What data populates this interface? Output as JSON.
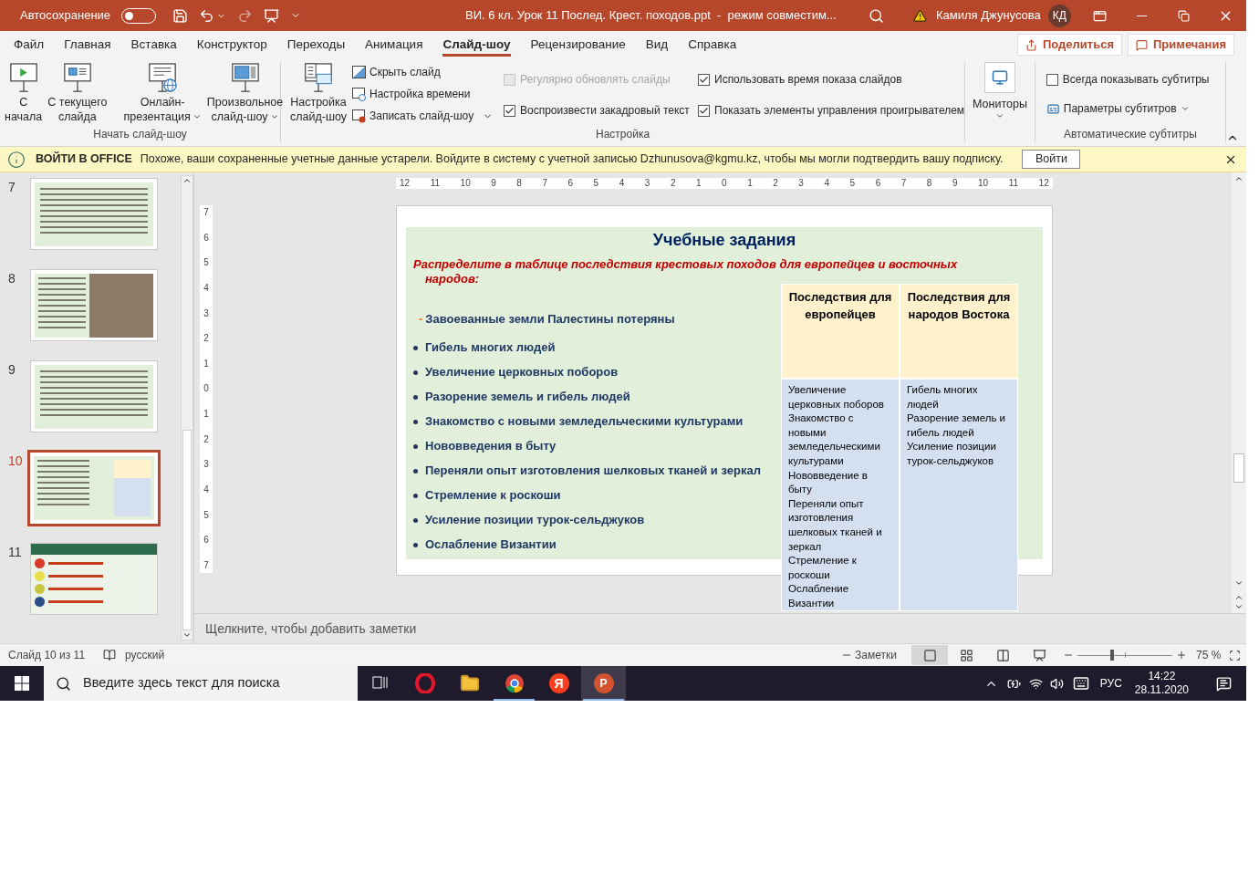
{
  "title_bar": {
    "autosave_label": "Автосохранение",
    "autosave_on": false,
    "title": "ВИ. 6 кл. Урок 11 Послед. Крест. походов.ppt  -  режим совместим...",
    "user_name": "Камиля Джунусова",
    "user_initials": "КД"
  },
  "menu_tabs": [
    {
      "label": "Файл",
      "selected": false
    },
    {
      "label": "Главная",
      "selected": false
    },
    {
      "label": "Вставка",
      "selected": false
    },
    {
      "label": "Конструктор",
      "selected": false
    },
    {
      "label": "Переходы",
      "selected": false
    },
    {
      "label": "Анимация",
      "selected": false
    },
    {
      "label": "Слайд-шоу",
      "selected": true
    },
    {
      "label": "Рецензирование",
      "selected": false
    },
    {
      "label": "Вид",
      "selected": false
    },
    {
      "label": "Справка",
      "selected": false
    }
  ],
  "share_button": "Поделиться",
  "comments_button": "Примечания",
  "ribbon": {
    "start_group": {
      "label": "Начать слайд-шоу",
      "buttons": [
        {
          "kind": "play",
          "lines": [
            "С",
            "начала"
          ],
          "dropdown": false
        },
        {
          "kind": "current",
          "lines": [
            "С текущего",
            "слайда"
          ],
          "dropdown": false
        },
        {
          "kind": "online",
          "lines": [
            "Онлайн-",
            "презентация"
          ],
          "dropdown": true
        },
        {
          "kind": "custom",
          "lines": [
            "Произвольное",
            "слайд-шоу"
          ],
          "dropdown": true
        }
      ]
    },
    "setup_group": {
      "label": "Настройка",
      "big_button": {
        "lines": [
          "Настройка",
          "слайд-шоу"
        ]
      },
      "small_buttons": [
        {
          "kind": "hide",
          "label": "Скрыть слайд",
          "dropdown": false
        },
        {
          "kind": "timing",
          "label": "Настройка времени",
          "dropdown": false
        },
        {
          "kind": "record",
          "label": "Записать слайд-шоу",
          "dropdown": true
        }
      ],
      "checkbox_columns": [
        [
          {
            "label": "Регулярно обновлять слайды",
            "checked": false,
            "disabled": true
          },
          {
            "label": "Воспроизвести закадровый текст",
            "checked": true,
            "disabled": false
          }
        ],
        [
          {
            "label": "Использовать время показа слайдов",
            "checked": true,
            "disabled": false
          },
          {
            "label": "Показать элементы управления проигрывателем",
            "checked": true,
            "disabled": false
          }
        ]
      ]
    },
    "monitors_button": "Мониторы",
    "subtitles_group": {
      "label": "Автоматические субтитры",
      "checkbox": {
        "label": "Всегда показывать субтитры",
        "checked": false,
        "disabled": false
      },
      "settings_button": "Параметры субтитров"
    }
  },
  "message_bar": {
    "title": "ВОЙТИ В OFFICE",
    "text": "Похоже, ваши сохраненные учетные данные устарели. Войдите в систему с учетной записью Dzhunusova@kgmu.kz, чтобы мы могли подтвердить вашу подписку.",
    "button": "Войти"
  },
  "thumbnails": [
    {
      "number": "7",
      "kind": "text",
      "selected": false
    },
    {
      "number": "8",
      "kind": "photo",
      "selected": false
    },
    {
      "number": "9",
      "kind": "text",
      "selected": false
    },
    {
      "number": "10",
      "kind": "table",
      "selected": true
    },
    {
      "number": "11",
      "kind": "reflection",
      "selected": false
    }
  ],
  "rulers": {
    "horizontal": [
      "12",
      "11",
      "10",
      "9",
      "8",
      "7",
      "6",
      "5",
      "4",
      "3",
      "2",
      "1",
      "0",
      "1",
      "2",
      "3",
      "4",
      "5",
      "6",
      "7",
      "8",
      "9",
      "10",
      "11",
      "12"
    ],
    "vertical": [
      "7",
      "6",
      "5",
      "4",
      "3",
      "2",
      "1",
      "0",
      "1",
      "2",
      "3",
      "4",
      "5",
      "6",
      "7"
    ]
  },
  "slide": {
    "title": "Учебные задания",
    "instruction": "Распределите в таблице последствия крестовых походов для европейцев и восточных народов:",
    "first_item": {
      "marker": "-",
      "text": "Завоеванные земли Палестины потеряны"
    },
    "bullets": [
      "Гибель многих людей",
      "Увеличение церковных поборов",
      "Разорение земель и гибель людей",
      "Знакомство с новыми земледельческими культурами",
      "Нововведения в быту",
      "Переняли опыт изготовления шелковых тканей и зеркал",
      "Стремление к роскоши",
      "Усиление позиции турок-сельджуков",
      "Ослабление Византии"
    ],
    "table": {
      "headers": [
        "Последствия для европейцев",
        "Последствия для народов Востока"
      ],
      "columns": [
        [
          "Увеличение церковных поборов",
          "Знакомство с новыми земледельческими культурами",
          "Нововведение в быту",
          "Переняли опыт изготовления шелковых тканей и зеркал",
          "Стремление к роскоши",
          "Ослабление Византии"
        ],
        [
          "Гибель многих людей",
          "Разорение земель и гибель людей",
          "Усиление позиции турок-сельджуков"
        ]
      ]
    }
  },
  "notes_placeholder": "Щелкните, чтобы добавить заметки",
  "status_bar": {
    "slide_count": "Слайд 10 из 11",
    "language": "русский",
    "notes_button": "Заметки",
    "views": [
      {
        "kind": "normal",
        "selected": true
      },
      {
        "kind": "sorter",
        "selected": false
      },
      {
        "kind": "reading",
        "selected": false
      },
      {
        "kind": "slideshow",
        "selected": false
      }
    ],
    "zoom": {
      "level": 0.37,
      "text": "75 %"
    }
  },
  "taskbar": {
    "search_placeholder": "Введите здесь текст для поиска",
    "apps": [
      {
        "kind": "task-view",
        "running": false,
        "selected": false
      },
      {
        "kind": "opera",
        "running": false,
        "selected": false
      },
      {
        "kind": "folder",
        "running": false,
        "selected": false
      },
      {
        "kind": "chrome",
        "running": true,
        "selected": false
      },
      {
        "kind": "yandex",
        "glyph": "Я",
        "running": false,
        "selected": false
      },
      {
        "kind": "powerpoint",
        "glyph": "P",
        "running": true,
        "selected": true
      }
    ],
    "language": "РУС",
    "time": "14:22",
    "date": "28.11.2020"
  }
}
